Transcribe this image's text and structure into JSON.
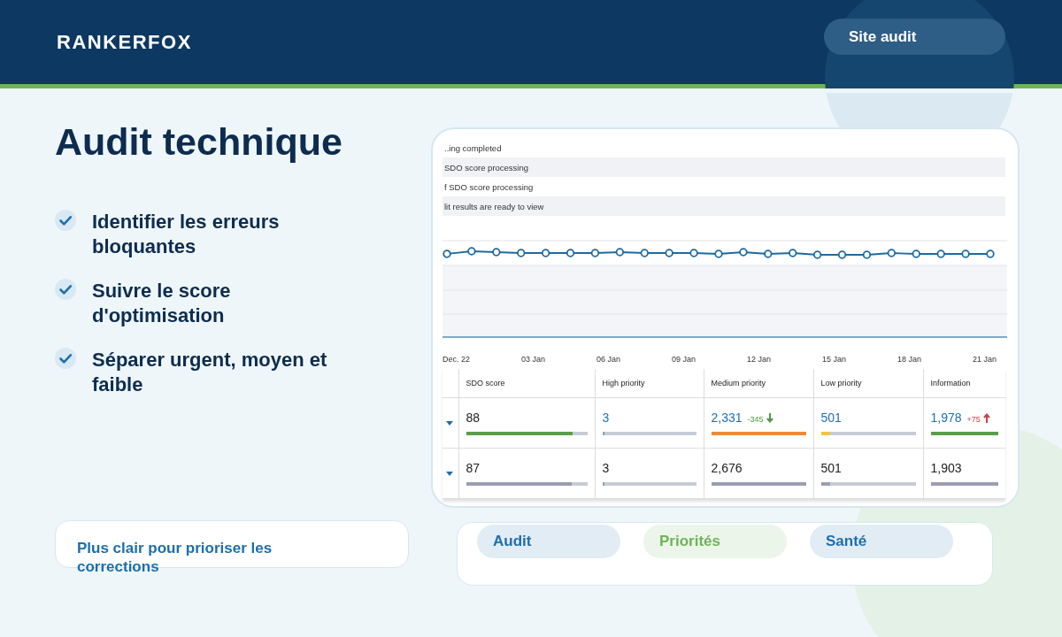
{
  "header": {
    "brand": "RANKERFOX",
    "badge": "Site audit"
  },
  "title": "Audit technique",
  "bullets": [
    {
      "text": "Identifier les erreurs bloquantes",
      "checked": true
    },
    {
      "text": "Suivre le score d'optimisation",
      "checked": true
    },
    {
      "text": "Séparer urgent, moyen et faible",
      "checked": true
    }
  ],
  "note": "Plus clair pour prioriser les corrections",
  "screenshot": {
    "events": [
      "..ing completed",
      "SDO score processing",
      "f SDO score processing",
      "lit results are ready to view"
    ],
    "x_labels": [
      "Dec. 22",
      "03 Jan",
      "06 Jan",
      "09 Jan",
      "12 Jan",
      "15 Jan",
      "18 Jan",
      "21 Jan"
    ],
    "columns": [
      "SDO score",
      "High priority",
      "Medium priority",
      "Low priority",
      "Information"
    ],
    "rows": [
      {
        "cells": [
          {
            "value": "88",
            "linked": false,
            "level": 0.88,
            "color": "#5a9e4a"
          },
          {
            "value": "3",
            "linked": true,
            "level": 0.01,
            "color": "#9aa0b4"
          },
          {
            "value": "2,331",
            "linked": true,
            "change": {
              "kind": "decrease",
              "text": "-345",
              "color": "#4f9a43"
            },
            "level": 1,
            "color": "#ef8a3a"
          },
          {
            "value": "501",
            "linked": true,
            "level": 0.1,
            "color": "#f0c541"
          },
          {
            "value": "1,978",
            "linked": true,
            "change": {
              "kind": "increase",
              "text": "+75",
              "color": "#c8434a"
            },
            "level": 1,
            "color": "#5a9e4a"
          }
        ]
      },
      {
        "cells": [
          {
            "value": "87",
            "linked": false,
            "level": 0.87,
            "color": "#9b9db3"
          },
          {
            "value": "3",
            "linked": false,
            "level": 0.01,
            "color": "#9b9db3"
          },
          {
            "value": "2,676",
            "linked": false,
            "level": 1,
            "color": "#9b9db3"
          },
          {
            "value": "501",
            "linked": false,
            "level": 0.1,
            "color": "#9b9db3"
          },
          {
            "value": "1,903",
            "linked": false,
            "level": 1,
            "color": "#9b9db3"
          }
        ]
      }
    ]
  },
  "tags": [
    {
      "label": "Audit",
      "color": "#1e6fae"
    },
    {
      "label": "Priorités",
      "color": "#6db35a"
    },
    {
      "label": "Santé",
      "color": "#1e6fae"
    }
  ]
}
